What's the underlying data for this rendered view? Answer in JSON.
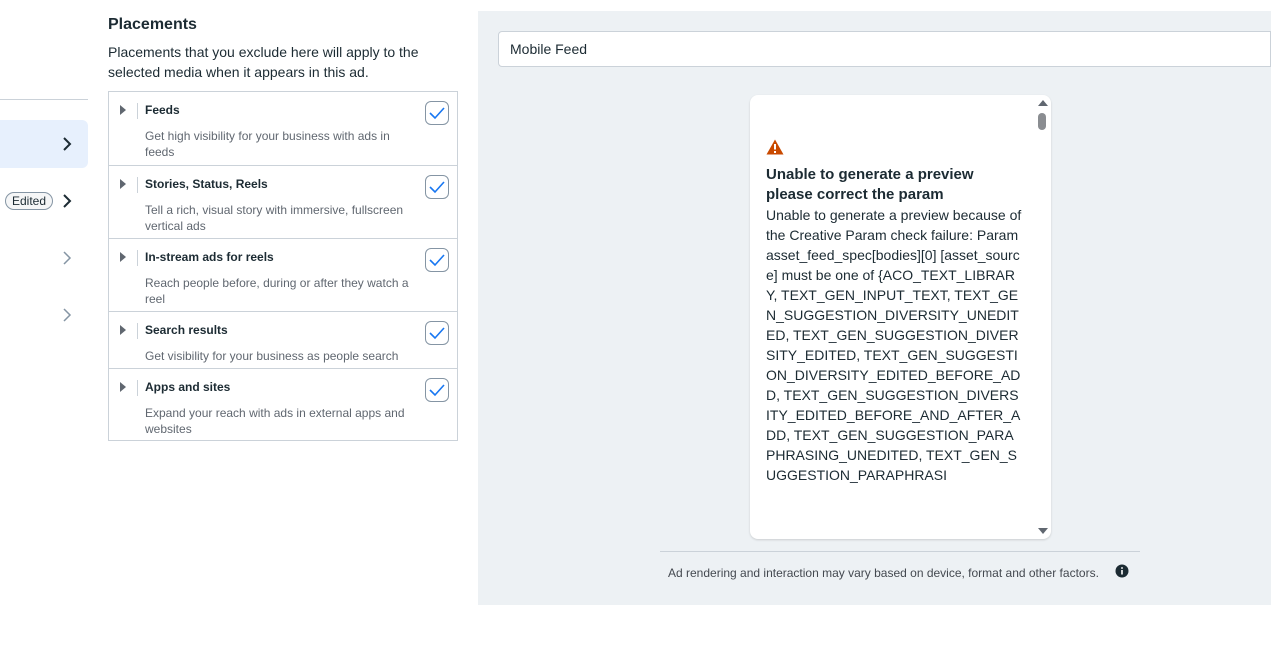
{
  "left_rail": {
    "edited_badge": "Edited"
  },
  "placements": {
    "title": "Placements",
    "description": "Placements that you exclude here will apply to the selected media when it appears in this ad.",
    "items": [
      {
        "title": "Feeds",
        "subtitle": "Get high visibility for your business with ads in feeds",
        "checked": true
      },
      {
        "title": "Stories, Status, Reels",
        "subtitle": "Tell a rich, visual story with immersive, fullscreen vertical ads",
        "checked": true
      },
      {
        "title": "In-stream ads for reels",
        "subtitle": "Reach people before, during or after they watch a reel",
        "checked": true
      },
      {
        "title": "Search results",
        "subtitle": "Get visibility for your business as people search",
        "checked": true
      },
      {
        "title": "Apps and sites",
        "subtitle": "Expand your reach with ads in external apps and websites",
        "checked": true
      }
    ]
  },
  "preview": {
    "selected_placement": "Mobile Feed",
    "error_title": "Unable to generate a preview please correct the param",
    "error_body": "Unable to generate a preview because of the Creative Param check failure: Param asset_feed_spec[bodies][0] [asset_source] must be one of {ACO_TEXT_LIBRARY, TEXT_GEN_INPUT_TEXT, TEXT_GEN_SUGGESTION_DIVERSITY_UNEDITED, TEXT_GEN_SUGGESTION_DIVERSITY_EDITED, TEXT_GEN_SUGGESTION_DIVERSITY_EDITED_BEFORE_ADD, TEXT_GEN_SUGGESTION_DIVERSITY_EDITED_BEFORE_AND_AFTER_ADD, TEXT_GEN_SUGGESTION_PARAPHRASING_UNEDITED, TEXT_GEN_SUGGESTION_PARAPHRASI",
    "footer_note": "Ad rendering and interaction may vary based on device, format and other factors."
  },
  "colors": {
    "accent": "#1877f2",
    "warning": "#c94a00",
    "panel_bg": "#edf1f4",
    "active_rail_bg": "#e7f0fd"
  }
}
